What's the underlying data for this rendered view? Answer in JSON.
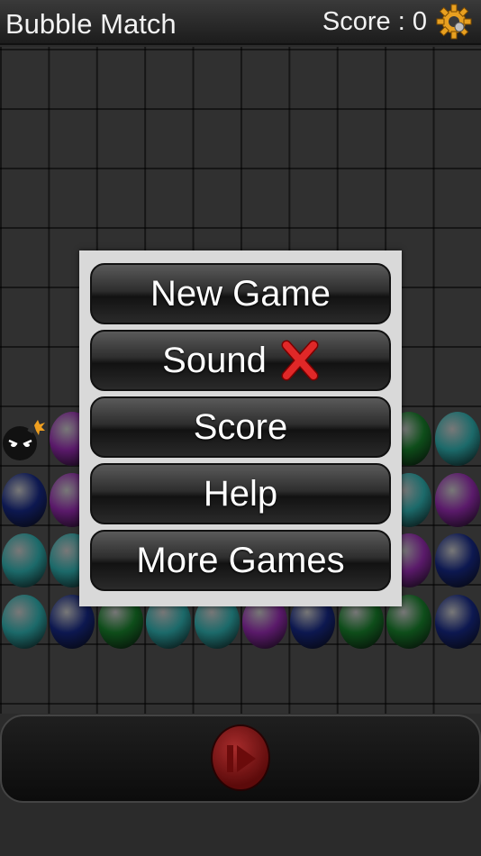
{
  "header": {
    "title": "Bubble Match",
    "score_label": "Score :",
    "score_value": "0",
    "settings_icon": "gear-icon"
  },
  "menu": {
    "items": [
      {
        "label": "New Game"
      },
      {
        "label": "Sound",
        "status_icon": "cross-icon"
      },
      {
        "label": "Score"
      },
      {
        "label": "Help"
      },
      {
        "label": "More Games"
      }
    ]
  },
  "bottom_bar": {
    "play_icon": "play-icon"
  },
  "colors": {
    "teal": "#1c6a6a",
    "purple": "#5a1a6a",
    "navy": "#0d1850",
    "green": "#0e4d1a",
    "menu_bg": "#d9d9d9",
    "play_red": "#b02020"
  }
}
